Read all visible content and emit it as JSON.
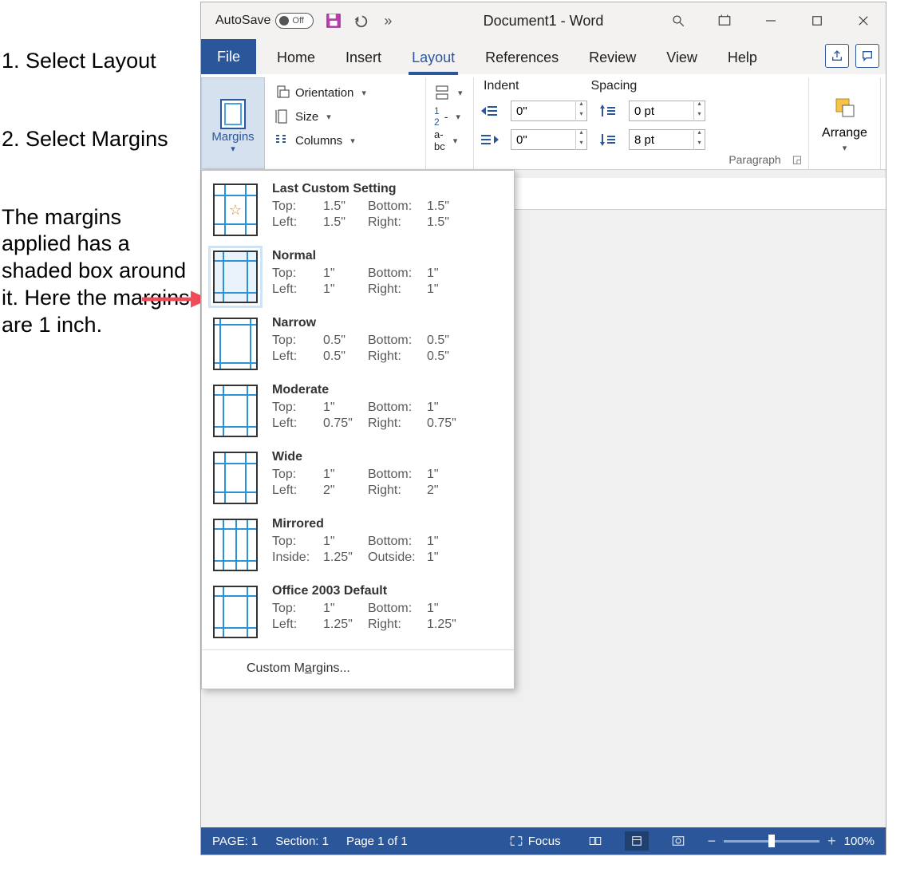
{
  "annotations": {
    "step1": "1. Select Layout",
    "step2": "2. Select Margins",
    "desc": "The margins applied has a shaded box around it. Here the margins are 1 inch."
  },
  "titlebar": {
    "autosave_label": "AutoSave",
    "autosave_state": "Off",
    "doc_title": "Document1  -  Word"
  },
  "tabs": {
    "file": "File",
    "items": [
      "Home",
      "Insert",
      "Layout",
      "References",
      "Review",
      "View",
      "Help"
    ],
    "active_index": 2
  },
  "ribbon": {
    "margins_label": "Margins",
    "orientation": "Orientation",
    "size": "Size",
    "columns": "Columns",
    "indent_header": "Indent",
    "spacing_header": "Spacing",
    "indent_left": "0\"",
    "indent_right": "0\"",
    "spacing_before": "0 pt",
    "spacing_after": "8 pt",
    "arrange": "Arrange",
    "paragraph_label": "Paragraph"
  },
  "margins_menu": {
    "options": [
      {
        "title": "Last Custom Setting",
        "l1a": "Top:",
        "l1b": "1.5\"",
        "l1c": "Bottom:",
        "l1d": "1.5\"",
        "l2a": "Left:",
        "l2b": "1.5\"",
        "l2c": "Right:",
        "l2d": "1.5\"",
        "star": true,
        "selected": false
      },
      {
        "title": "Normal",
        "l1a": "Top:",
        "l1b": "1\"",
        "l1c": "Bottom:",
        "l1d": "1\"",
        "l2a": "Left:",
        "l2b": "1\"",
        "l2c": "Right:",
        "l2d": "1\"",
        "star": false,
        "selected": true
      },
      {
        "title": "Narrow",
        "l1a": "Top:",
        "l1b": "0.5\"",
        "l1c": "Bottom:",
        "l1d": "0.5\"",
        "l2a": "Left:",
        "l2b": "0.5\"",
        "l2c": "Right:",
        "l2d": "0.5\"",
        "star": false,
        "selected": false
      },
      {
        "title": "Moderate",
        "l1a": "Top:",
        "l1b": "1\"",
        "l1c": "Bottom:",
        "l1d": "1\"",
        "l2a": "Left:",
        "l2b": "0.75\"",
        "l2c": "Right:",
        "l2d": "0.75\"",
        "star": false,
        "selected": false
      },
      {
        "title": "Wide",
        "l1a": "Top:",
        "l1b": "1\"",
        "l1c": "Bottom:",
        "l1d": "1\"",
        "l2a": "Left:",
        "l2b": "2\"",
        "l2c": "Right:",
        "l2d": "2\"",
        "star": false,
        "selected": false
      },
      {
        "title": "Mirrored",
        "l1a": "Top:",
        "l1b": "1\"",
        "l1c": "Bottom:",
        "l1d": "1\"",
        "l2a": "Inside:",
        "l2b": "1.25\"",
        "l2c": "Outside:",
        "l2d": "1\"",
        "star": false,
        "selected": false
      },
      {
        "title": "Office 2003 Default",
        "l1a": "Top:",
        "l1b": "1\"",
        "l1c": "Bottom:",
        "l1d": "1\"",
        "l2a": "Left:",
        "l2b": "1.25\"",
        "l2c": "Right:",
        "l2d": "1.25\"",
        "star": false,
        "selected": false
      }
    ],
    "custom": "Custom Margins..."
  },
  "statusbar": {
    "page": "PAGE: 1",
    "section": "Section: 1",
    "pages": "Page 1 of 1",
    "focus": "Focus",
    "zoom": "100%"
  }
}
